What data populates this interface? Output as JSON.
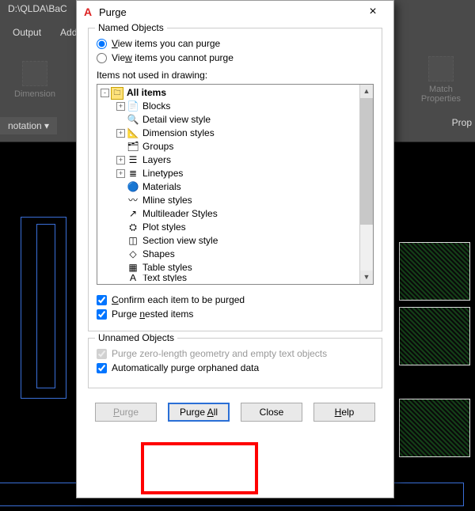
{
  "background": {
    "path": "D:\\QLDA\\BaC",
    "tabs": {
      "output": "Output",
      "addins": "Add"
    },
    "panel": {
      "dimension": "Dimension",
      "match": "Match\nProperties",
      "annotation": "notation  ▾",
      "prop": "Prop"
    }
  },
  "dialog": {
    "title": "Purge",
    "named_legend": "Named Objects",
    "radios": {
      "can_label": "View items you can purge",
      "cannot_label": "View items you cannot purge"
    },
    "tree_label": "Items not used in drawing:",
    "tree": {
      "root": "All items",
      "items": [
        "Blocks",
        "Detail view style",
        "Dimension styles",
        "Groups",
        "Layers",
        "Linetypes",
        "Materials",
        "Mline styles",
        "Multileader Styles",
        "Plot styles",
        "Section view style",
        "Shapes",
        "Table styles",
        "Text styles"
      ],
      "expandable": {
        "Blocks": true,
        "Dimension styles": true,
        "Layers": true,
        "Linetypes": true
      }
    },
    "checks": {
      "confirm": "Confirm each item to be purged",
      "nested": "Purge nested items",
      "zerolen": "Purge zero-length geometry and empty text objects",
      "orphan": "Automatically purge orphaned data"
    },
    "unnamed_legend": "Unnamed Objects",
    "buttons": {
      "purge": "Purge",
      "purge_all": "Purge All",
      "close": "Close",
      "help": "Help"
    }
  }
}
